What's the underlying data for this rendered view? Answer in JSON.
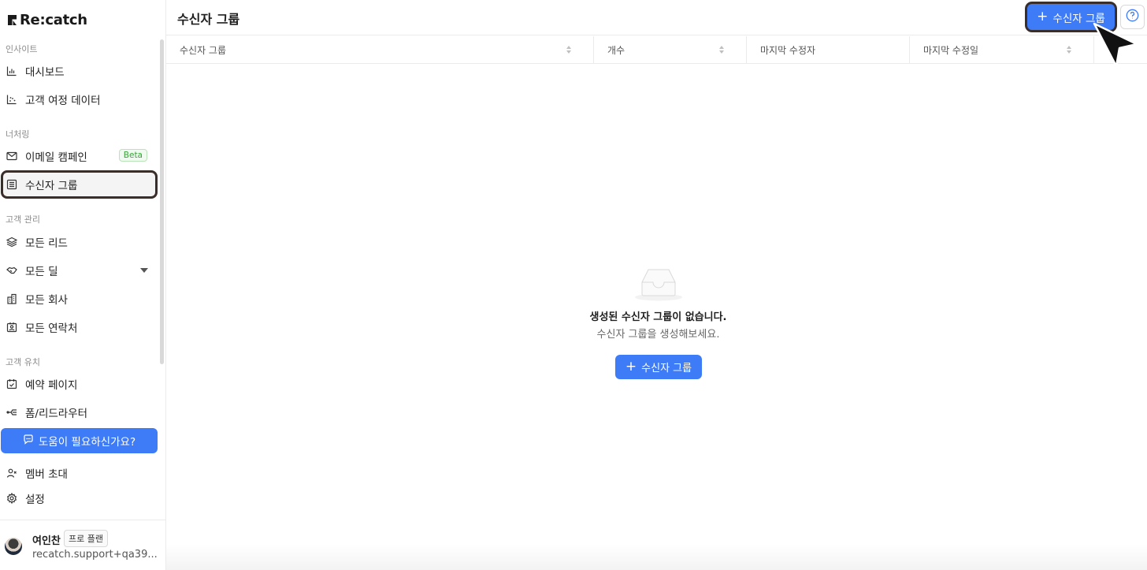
{
  "app": {
    "logo_text": "Re:catch"
  },
  "sidebar": {
    "sections": [
      {
        "label": "인사이트"
      },
      {
        "label": "너처링"
      },
      {
        "label": "고객 관리"
      },
      {
        "label": "고객 유치"
      }
    ],
    "items": [
      {
        "label": "대시보드",
        "icon": "bar-chart-icon"
      },
      {
        "label": "고객 여정 데이터",
        "icon": "scatter-chart-icon"
      },
      {
        "label": "이메일 캠페인",
        "icon": "mail-icon",
        "badge": "Beta"
      },
      {
        "label": "수신자 그룹",
        "icon": "list-icon",
        "active": true
      },
      {
        "label": "모든 리드",
        "icon": "layers-icon"
      },
      {
        "label": "모든 딜",
        "icon": "handshake-icon"
      },
      {
        "label": "모든 회사",
        "icon": "building-icon"
      },
      {
        "label": "모든 연락처",
        "icon": "contact-card-icon"
      },
      {
        "label": "예약 페이지",
        "icon": "calendar-check-icon"
      },
      {
        "label": "폼/리드라우터",
        "icon": "router-icon"
      },
      {
        "label": "멤버 초대",
        "icon": "invite-user-icon"
      },
      {
        "label": "설정",
        "icon": "gear-icon"
      }
    ],
    "help_button": "도움이 필요하신가요?",
    "user": {
      "name": "여인찬",
      "plan": "프로 플랜",
      "email": "recatch.support+qa39..."
    }
  },
  "header": {
    "title": "수신자 그룹",
    "add_button": "수신자 그룹"
  },
  "table": {
    "columns": [
      "수신자 그룹",
      "개수",
      "마지막 수정자",
      "마지막 수정일"
    ]
  },
  "empty_state": {
    "title": "생성된 수신자 그룹이 없습니다.",
    "subtitle": "수신자 그룹을 생성해보세요.",
    "button": "수신자 그룹"
  },
  "colors": {
    "accent": "#3e7bf6",
    "highlight_border": "#3a2e2a",
    "beta_green": "#3aa33a"
  }
}
